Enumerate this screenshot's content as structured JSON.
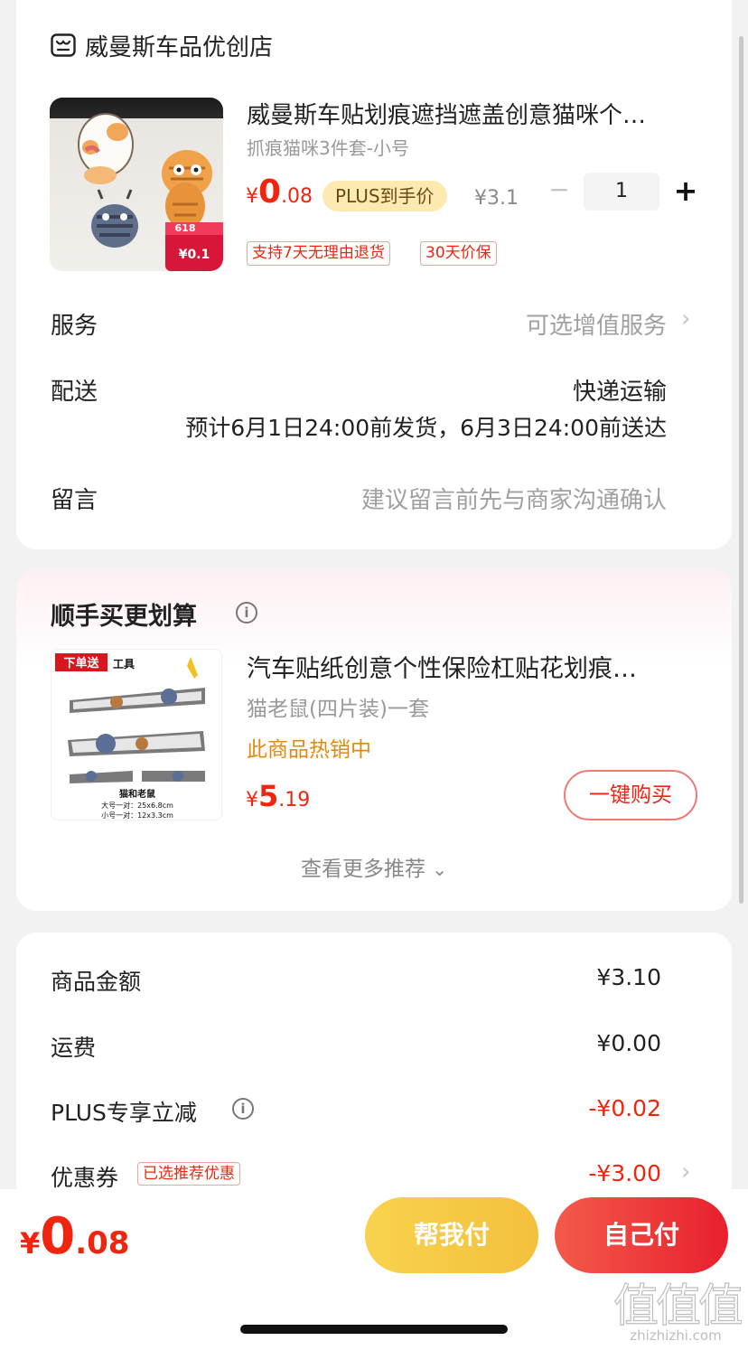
{
  "shop": {
    "name": "威曼斯车品优创店"
  },
  "product": {
    "title": "威曼斯车贴划痕遮挡遮盖创意猫咪个…",
    "variant": "抓痕猫咪3件套-小号",
    "price_symbol": "¥",
    "price_int": "0",
    "price_dec": ".08",
    "plus_label": "PLUS到手价",
    "original_price": "¥3.1",
    "quantity": "1",
    "minus_glyph": "−",
    "plus_glyph": "+",
    "badge_618": "618",
    "badge_price": "¥0.1",
    "tags": [
      "支持7天无理由退货",
      "30天价保"
    ]
  },
  "service": {
    "label": "服务",
    "value": "可选增值服务",
    "chevron": "›"
  },
  "delivery": {
    "label": "配送",
    "method": "快递运输",
    "eta": "预计6月1日24:00前发货，6月3日24:00前送达"
  },
  "message": {
    "label": "留言",
    "placeholder": "建议留言前先与商家沟通确认"
  },
  "recommend": {
    "title": "顺手买更划算",
    "info_glyph": "i",
    "item": {
      "name": "汽车贴纸创意个性保险杠贴花划痕…",
      "variant": "猫老鼠(四片装)一套",
      "hot": "此商品热销中",
      "price_symbol": "¥",
      "price_int": "5",
      "price_dec": ".19",
      "buy_label": "一键购买",
      "img_tag": "下单送",
      "img_tool": "工具",
      "img_caption": "猫和老鼠",
      "img_size_large": "大号一对：25x6.8cm",
      "img_size_small": "小号一对：12x3.3cm"
    },
    "more_label": "查看更多推荐",
    "more_chevron": "⌄"
  },
  "summary": {
    "rows": [
      {
        "label": "商品金额",
        "value": "¥3.10"
      },
      {
        "label": "运费",
        "value": "¥0.00"
      },
      {
        "label": "PLUS专享立减",
        "value": "-¥0.02"
      },
      {
        "label": "优惠券",
        "value": "-¥3.00",
        "tag": "已选推荐优惠"
      }
    ]
  },
  "footer": {
    "total_symbol": "¥",
    "total_int": "0",
    "total_dec": ".08",
    "help_pay_label": "帮我付",
    "self_pay_label": "自己付"
  },
  "watermark": {
    "brand": "值",
    "site": "zhizhizhi.com"
  },
  "colors": {
    "accent": "#f0250f",
    "plus_bg": "#fdeab0",
    "help_btn": "#f8d24e",
    "self_btn": "#ec3a36"
  }
}
